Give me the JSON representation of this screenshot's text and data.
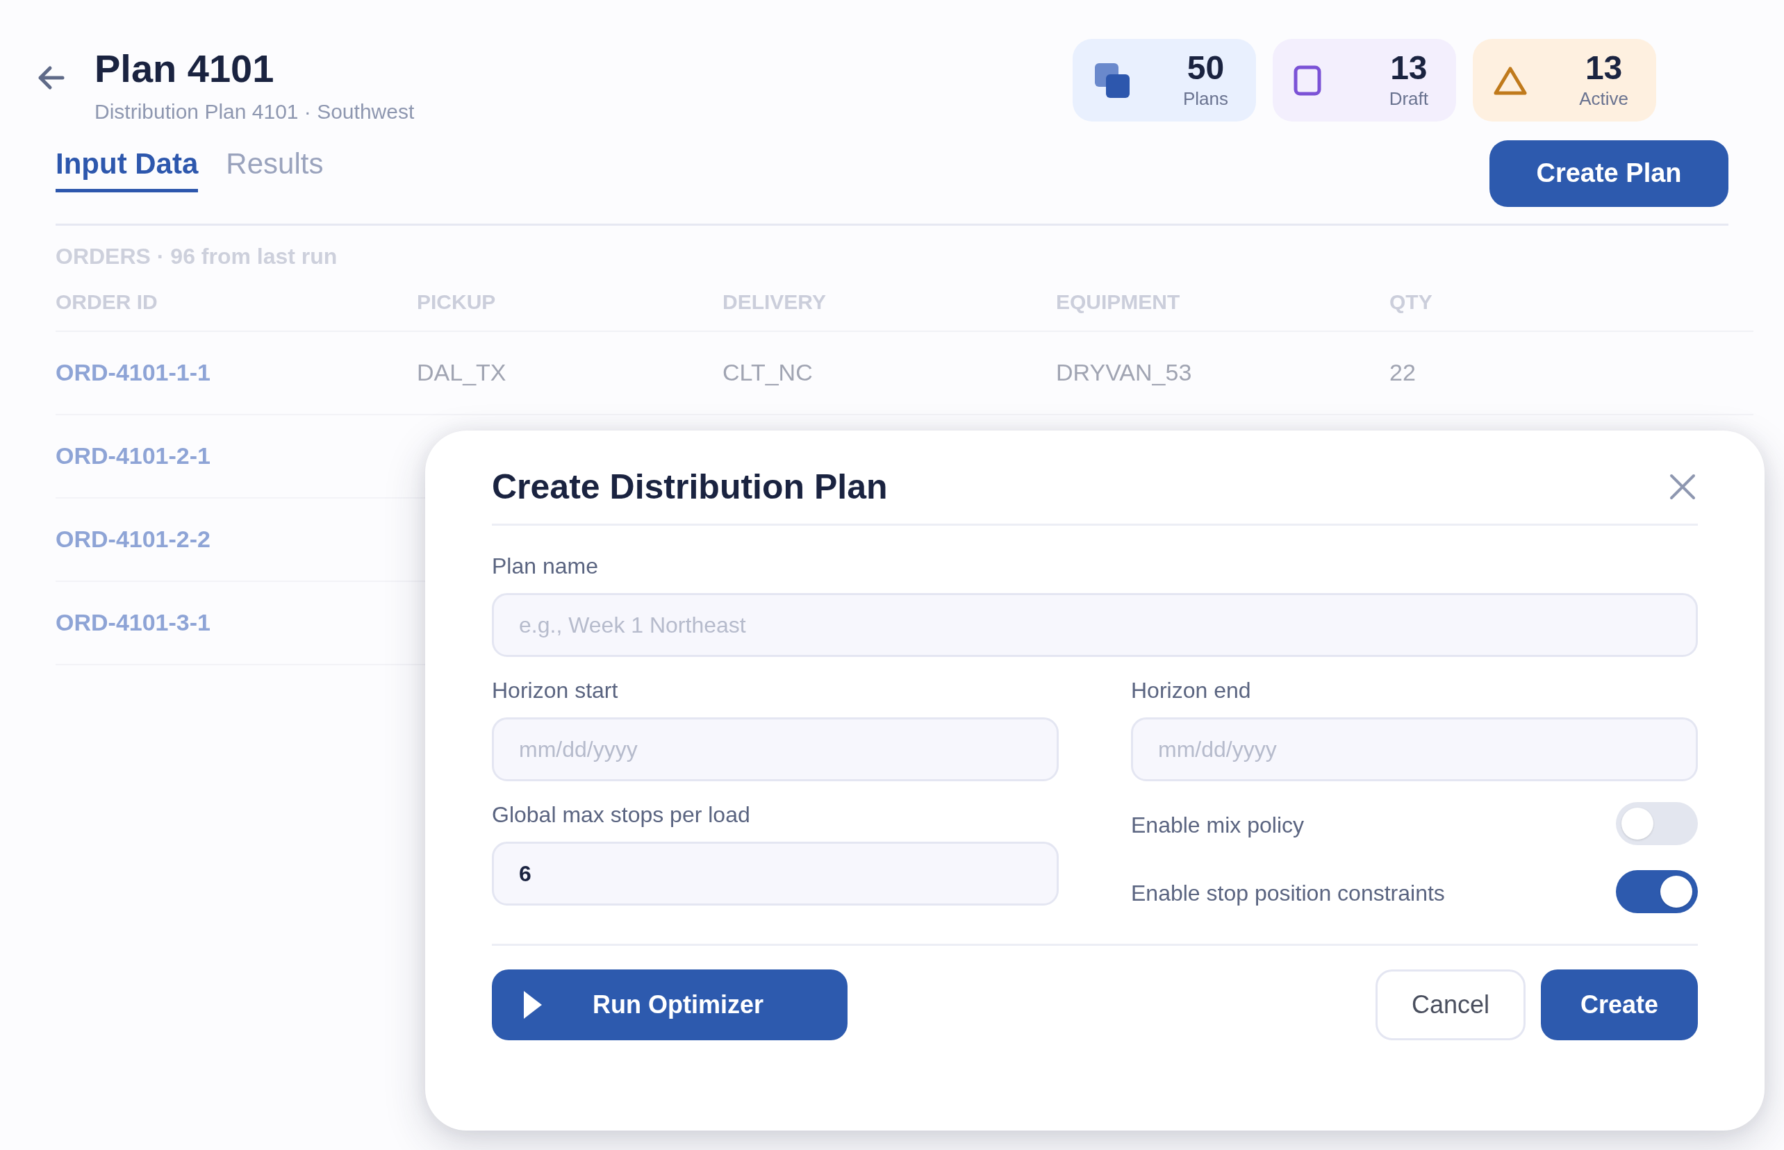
{
  "header": {
    "title": "Plan 4101",
    "subtitle": "Distribution Plan 4101 · Southwest"
  },
  "stats": [
    {
      "kind": "stack",
      "value": "50",
      "label": "Plans"
    },
    {
      "kind": "square",
      "value": "13",
      "label": "Draft"
    },
    {
      "kind": "warning",
      "value": "13",
      "label": "Active"
    }
  ],
  "tabs": [
    {
      "label": "Input Data",
      "selected": true
    },
    {
      "label": "Results",
      "selected": false
    }
  ],
  "create_plan_button": "Create Plan",
  "orders": {
    "caption": "ORDERS · 96 from last run",
    "columns": [
      "ORDER ID",
      "PICKUP",
      "DELIVERY",
      "EQUIPMENT",
      "QTY"
    ],
    "rows": [
      [
        "ORD-4101-1-1",
        "DAL_TX",
        "CLT_NC",
        "DRYVAN_53",
        "22"
      ],
      [
        "ORD-4101-2-1"
      ],
      [
        "ORD-4101-2-2"
      ],
      [
        "ORD-4101-3-1"
      ]
    ]
  },
  "dialog": {
    "title": "Create Distribution Plan",
    "plan_name": {
      "label": "Plan name",
      "placeholder": "e.g., Week 1 Northeast"
    },
    "horizon_start": {
      "label": "Horizon start",
      "placeholder": "mm/dd/yyyy"
    },
    "horizon_end": {
      "label": "Horizon end",
      "placeholder": "mm/dd/yyyy"
    },
    "max_stops": {
      "label": "Global max stops per load",
      "value": "6"
    },
    "toggles": [
      {
        "label": "Enable mix policy",
        "on": false
      },
      {
        "label": "Enable stop position constraints",
        "on": true
      }
    ],
    "buttons": [
      {
        "kind": "run",
        "label": "Run Optimizer"
      },
      {
        "kind": "secondary",
        "label": "Cancel"
      },
      {
        "kind": "primary",
        "label": "Create"
      }
    ]
  }
}
